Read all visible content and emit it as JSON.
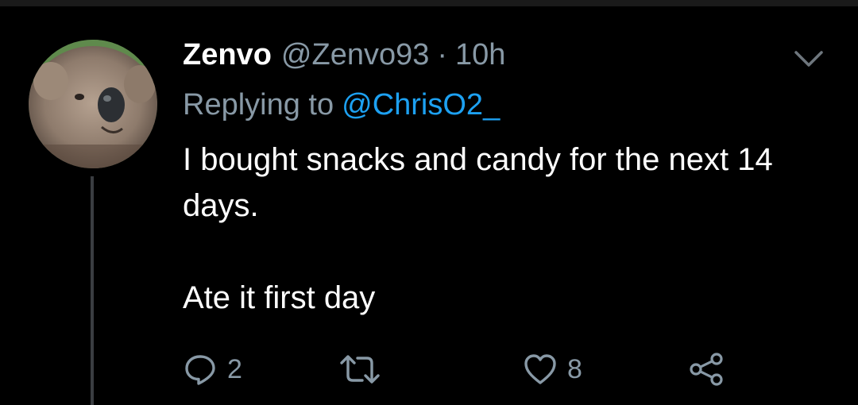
{
  "tweet": {
    "display_name": "Zenvo",
    "handle": "@Zenvo93",
    "separator": "·",
    "time": "10h",
    "replying_to_label": "Replying to",
    "replying_to_handle": "@ChrisO2_",
    "text_lines": [
      "I bought snacks and candy for the next 14 days.",
      "Ate it first day"
    ],
    "reply_count": "2",
    "like_count": "8"
  },
  "icons": {
    "avatar": "koala-avatar",
    "menu": "chevron-down-icon",
    "reply": "reply-icon",
    "retweet": "retweet-icon",
    "like": "heart-icon",
    "share": "share-icon"
  },
  "colors": {
    "background": "#000000",
    "text": "#ffffff",
    "secondary": "#8899a6",
    "link": "#1da1f2",
    "thread_line": "#3a3d41"
  }
}
